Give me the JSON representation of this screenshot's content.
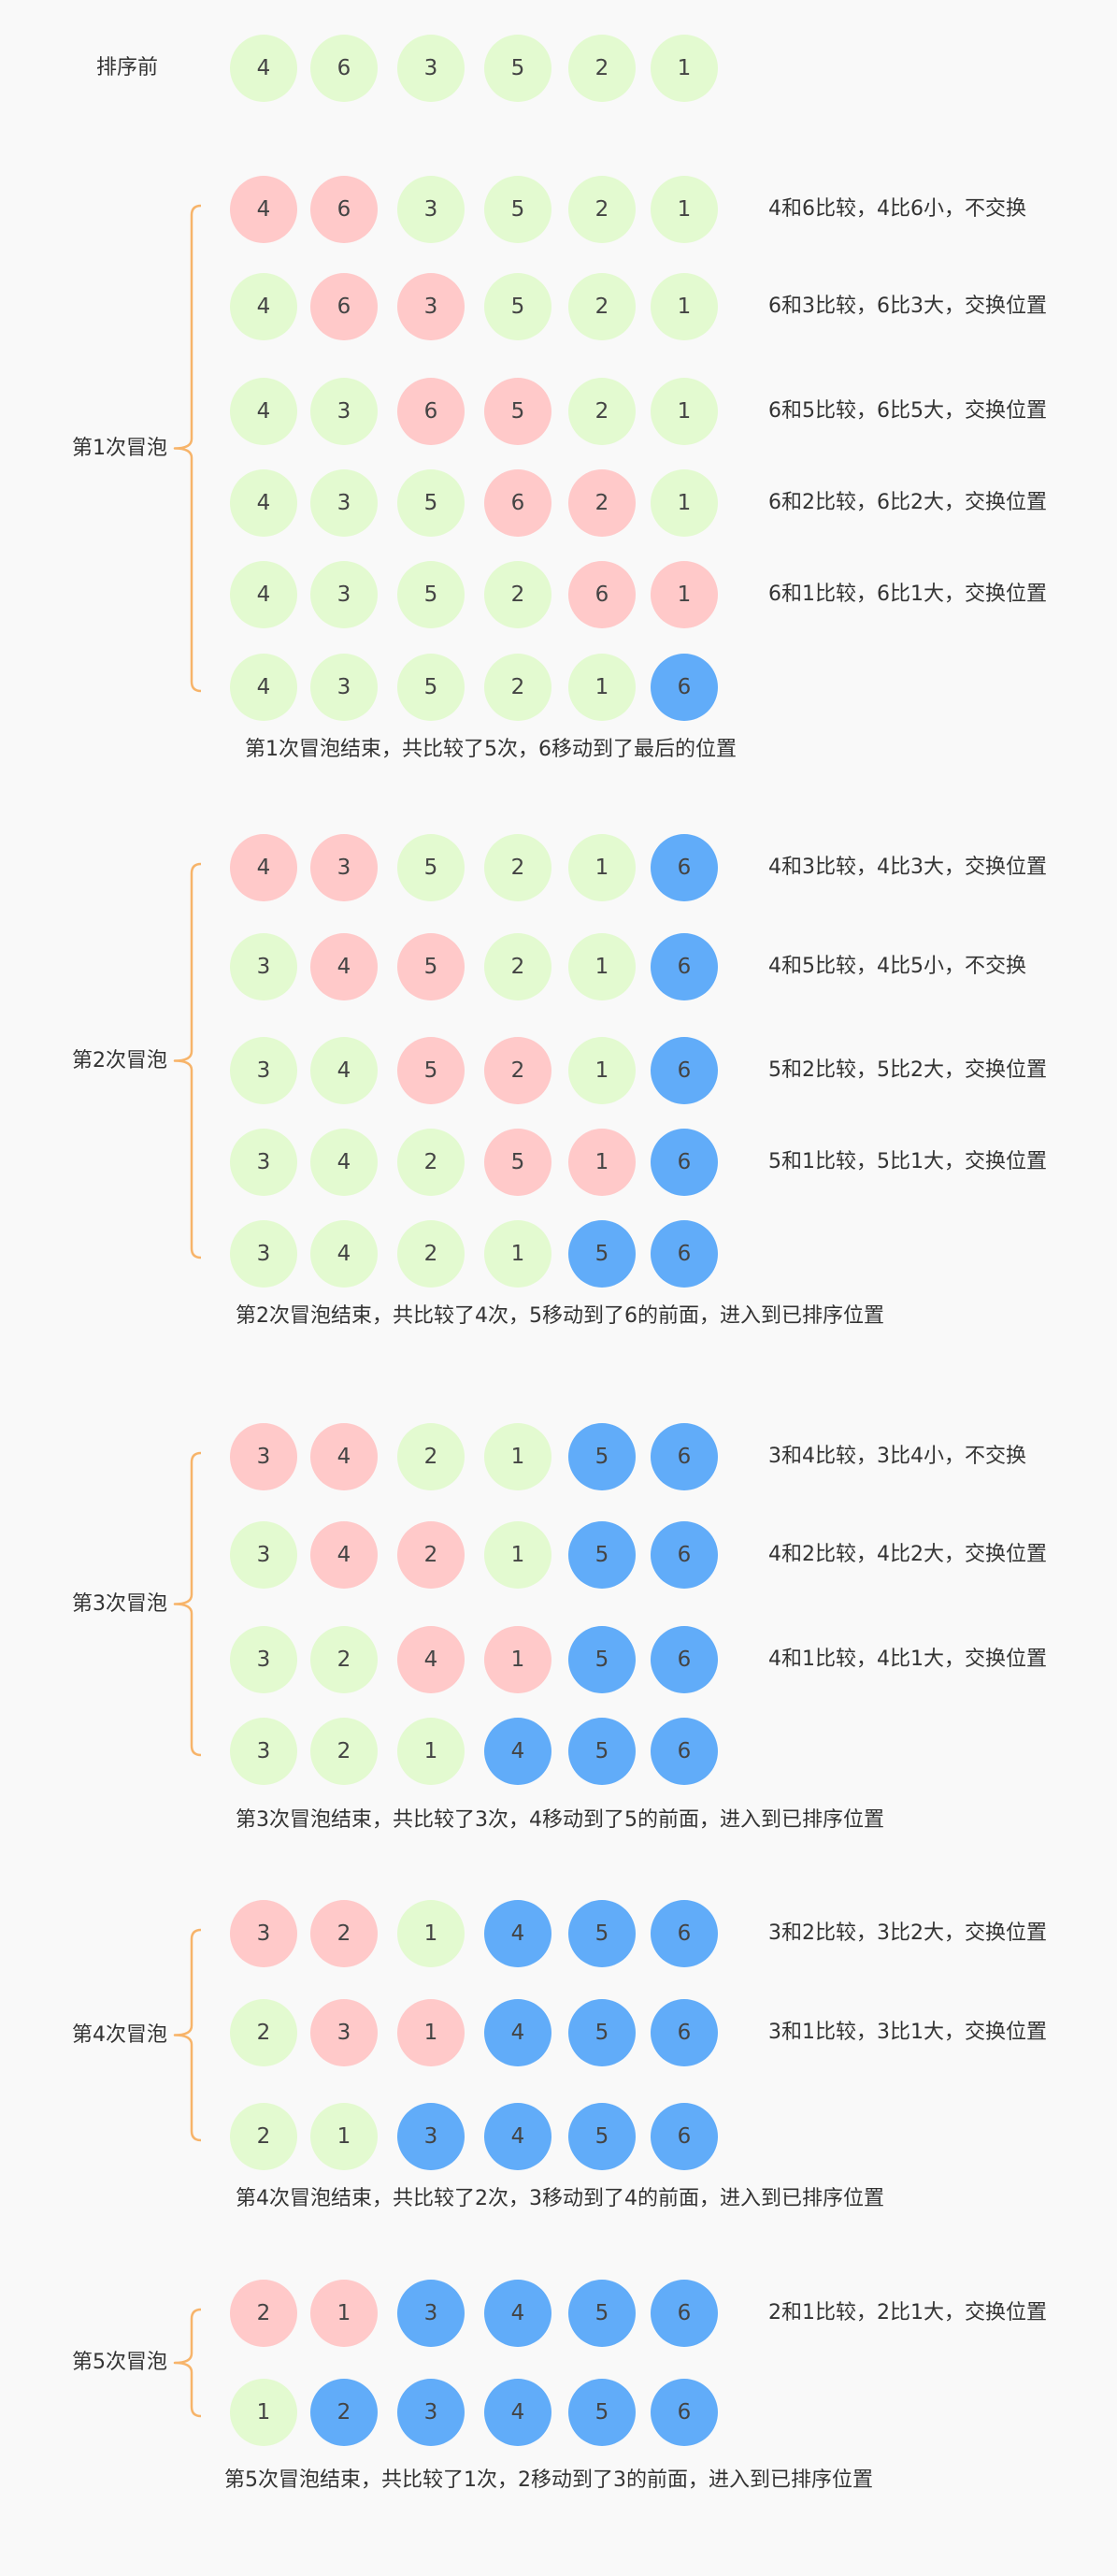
{
  "colors": {
    "background": "#f9f9f9",
    "unsorted": "#e3fad0",
    "comparing": "#ffc9c9",
    "sorted": "#61acf9",
    "bracket": "#f7b46a",
    "text": "#333333"
  },
  "legend_key": {
    "g": "unsorted",
    "r": "comparing",
    "b": "sorted"
  },
  "initial": {
    "label": "排序前",
    "values": [
      4,
      6,
      3,
      5,
      2,
      1
    ],
    "states": "gggggg"
  },
  "passes": [
    {
      "label": "第1次冒泡",
      "steps": [
        {
          "values": [
            4,
            6,
            3,
            5,
            2,
            1
          ],
          "states": "rrgggg",
          "note": "4和6比较，4比6小，不交换"
        },
        {
          "values": [
            4,
            6,
            3,
            5,
            2,
            1
          ],
          "states": "grrggg",
          "note": "6和3比较，6比3大，交换位置"
        },
        {
          "values": [
            4,
            3,
            6,
            5,
            2,
            1
          ],
          "states": "ggrrgg",
          "note": "6和5比较，6比5大，交换位置"
        },
        {
          "values": [
            4,
            3,
            5,
            6,
            2,
            1
          ],
          "states": "gggrrg",
          "note": "6和2比较，6比2大，交换位置"
        },
        {
          "values": [
            4,
            3,
            5,
            2,
            6,
            1
          ],
          "states": "ggggrr",
          "note": "6和1比较，6比1大，交换位置"
        },
        {
          "values": [
            4,
            3,
            5,
            2,
            1,
            6
          ],
          "states": "gggggb",
          "note": ""
        }
      ],
      "summary": "第1次冒泡结束，共比较了5次，6移动到了最后的位置"
    },
    {
      "label": "第2次冒泡",
      "steps": [
        {
          "values": [
            4,
            3,
            5,
            2,
            1,
            6
          ],
          "states": "rrgggb",
          "note": "4和3比较，4比3大，交换位置"
        },
        {
          "values": [
            3,
            4,
            5,
            2,
            1,
            6
          ],
          "states": "grrggb",
          "note": "4和5比较，4比5小，不交换"
        },
        {
          "values": [
            3,
            4,
            5,
            2,
            1,
            6
          ],
          "states": "ggrrgb",
          "note": "5和2比较，5比2大，交换位置"
        },
        {
          "values": [
            3,
            4,
            2,
            5,
            1,
            6
          ],
          "states": "gggrrb",
          "note": "5和1比较，5比1大，交换位置"
        },
        {
          "values": [
            3,
            4,
            2,
            1,
            5,
            6
          ],
          "states": "ggggbb",
          "note": ""
        }
      ],
      "summary": "第2次冒泡结束，共比较了4次，5移动到了6的前面，进入到已排序位置"
    },
    {
      "label": "第3次冒泡",
      "steps": [
        {
          "values": [
            3,
            4,
            2,
            1,
            5,
            6
          ],
          "states": "rrggbb",
          "note": "3和4比较，3比4小，不交换"
        },
        {
          "values": [
            3,
            4,
            2,
            1,
            5,
            6
          ],
          "states": "grrgbb",
          "note": "4和2比较，4比2大，交换位置"
        },
        {
          "values": [
            3,
            2,
            4,
            1,
            5,
            6
          ],
          "states": "ggrrbb",
          "note": "4和1比较，4比1大，交换位置"
        },
        {
          "values": [
            3,
            2,
            1,
            4,
            5,
            6
          ],
          "states": "gggbbb",
          "note": ""
        }
      ],
      "summary": "第3次冒泡结束，共比较了3次，4移动到了5的前面，进入到已排序位置"
    },
    {
      "label": "第4次冒泡",
      "steps": [
        {
          "values": [
            3,
            2,
            1,
            4,
            5,
            6
          ],
          "states": "rrgbbb",
          "note": "3和2比较，3比2大，交换位置"
        },
        {
          "values": [
            2,
            3,
            1,
            4,
            5,
            6
          ],
          "states": "grrbbb",
          "note": "3和1比较，3比1大，交换位置"
        },
        {
          "values": [
            2,
            1,
            3,
            4,
            5,
            6
          ],
          "states": "ggbbbb",
          "note": ""
        }
      ],
      "summary": "第4次冒泡结束，共比较了2次，3移动到了4的前面，进入到已排序位置"
    },
    {
      "label": "第5次冒泡",
      "steps": [
        {
          "values": [
            2,
            1,
            3,
            4,
            5,
            6
          ],
          "states": "rrbbbb",
          "note": "2和1比较，2比1大，交换位置"
        },
        {
          "values": [
            1,
            2,
            3,
            4,
            5,
            6
          ],
          "states": "gbbbbb",
          "note": ""
        }
      ],
      "summary": "第5次冒泡结束，共比较了1次，2移动到了3的前面，进入到已排序位置"
    }
  ]
}
